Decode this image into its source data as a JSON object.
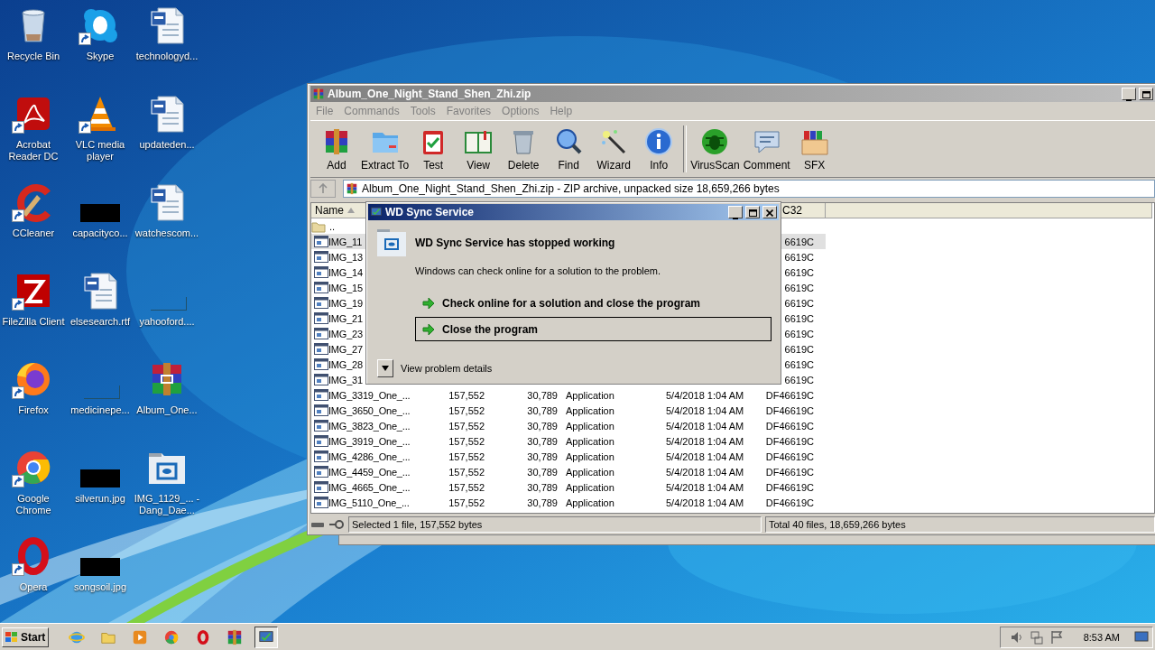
{
  "desktop": {
    "icons": [
      {
        "label": "Recycle Bin",
        "shortcut": false
      },
      {
        "label": "Skype",
        "shortcut": true
      },
      {
        "label": "technologyd...",
        "shortcut": false
      },
      {
        "label": "Acrobat Reader DC",
        "shortcut": true
      },
      {
        "label": "VLC media player",
        "shortcut": true
      },
      {
        "label": "updateden...",
        "shortcut": false
      },
      {
        "label": "CCleaner",
        "shortcut": true
      },
      {
        "label": "capacityco...",
        "shortcut": false
      },
      {
        "label": "watchescom...",
        "shortcut": false
      },
      {
        "label": "FileZilla Client",
        "shortcut": true
      },
      {
        "label": "elsesearch.rtf",
        "shortcut": false
      },
      {
        "label": "yahooford....",
        "shortcut": false
      },
      {
        "label": "Firefox",
        "shortcut": true
      },
      {
        "label": "medicinepe...",
        "shortcut": false
      },
      {
        "label": "Album_One...",
        "shortcut": false
      },
      {
        "label": "Google Chrome",
        "shortcut": true
      },
      {
        "label": "silverun.jpg",
        "shortcut": false
      },
      {
        "label": "IMG_1129_... - Dang_Dae...",
        "shortcut": false
      },
      {
        "label": "Opera",
        "shortcut": true
      },
      {
        "label": "songsoil.jpg",
        "shortcut": false
      }
    ]
  },
  "archive_window": {
    "title": "Album_One_Night_Stand_Shen_Zhi.zip",
    "active": false,
    "menu": [
      "File",
      "Commands",
      "Tools",
      "Favorites",
      "Options",
      "Help"
    ],
    "toolbar": {
      "groups": [
        {
          "buttons": [
            "Add",
            "Extract To",
            "Test",
            "View",
            "Delete",
            "Find",
            "Wizard",
            "Info"
          ]
        },
        {
          "buttons": [
            "VirusScan",
            "Comment",
            "SFX"
          ]
        }
      ]
    },
    "path": "Album_One_Night_Stand_Shen_Zhi.zip - ZIP archive, unpacked size 18,659,266 bytes",
    "table": {
      "columns": [
        {
          "label": "Name",
          "sorted": true
        },
        {
          "label": "C32",
          "sorted": false
        }
      ],
      "parent_row": {
        "name": ".."
      },
      "rows": [
        {
          "name": "IMG_11",
          "crc": "6619C",
          "selected": true
        },
        {
          "name": "IMG_13",
          "crc": "6619C",
          "selected": false
        },
        {
          "name": "IMG_14",
          "crc": "6619C",
          "selected": false
        },
        {
          "name": "IMG_15",
          "crc": "6619C",
          "selected": false
        },
        {
          "name": "IMG_19",
          "crc": "6619C",
          "selected": false
        },
        {
          "name": "IMG_21",
          "crc": "6619C",
          "selected": false
        },
        {
          "name": "IMG_23",
          "crc": "6619C",
          "selected": false
        },
        {
          "name": "IMG_27",
          "crc": "6619C",
          "selected": false
        },
        {
          "name": "IMG_28",
          "crc": "6619C",
          "selected": false
        },
        {
          "name": "IMG_31",
          "crc": "6619C",
          "selected": false
        },
        {
          "name": "IMG_3319_One_...",
          "size": "157,552",
          "packed": "30,789",
          "type": "Application",
          "modified": "5/4/2018 1:04 AM",
          "crc": "DF46619C",
          "selected": false
        },
        {
          "name": "IMG_3650_One_...",
          "size": "157,552",
          "packed": "30,789",
          "type": "Application",
          "modified": "5/4/2018 1:04 AM",
          "crc": "DF46619C",
          "selected": false
        },
        {
          "name": "IMG_3823_One_...",
          "size": "157,552",
          "packed": "30,789",
          "type": "Application",
          "modified": "5/4/2018 1:04 AM",
          "crc": "DF46619C",
          "selected": false
        },
        {
          "name": "IMG_3919_One_...",
          "size": "157,552",
          "packed": "30,789",
          "type": "Application",
          "modified": "5/4/2018 1:04 AM",
          "crc": "DF46619C",
          "selected": false
        },
        {
          "name": "IMG_4286_One_...",
          "size": "157,552",
          "packed": "30,789",
          "type": "Application",
          "modified": "5/4/2018 1:04 AM",
          "crc": "DF46619C",
          "selected": false
        },
        {
          "name": "IMG_4459_One_...",
          "size": "157,552",
          "packed": "30,789",
          "type": "Application",
          "modified": "5/4/2018 1:04 AM",
          "crc": "DF46619C",
          "selected": false
        },
        {
          "name": "IMG_4665_One_...",
          "size": "157,552",
          "packed": "30,789",
          "type": "Application",
          "modified": "5/4/2018 1:04 AM",
          "crc": "DF46619C",
          "selected": false
        },
        {
          "name": "IMG_5110_One_...",
          "size": "157,552",
          "packed": "30,789",
          "type": "Application",
          "modified": "5/4/2018 1:04 AM",
          "crc": "DF46619C",
          "selected": false
        }
      ]
    },
    "status_bar": {
      "selection": "Selected 1 file, 157,552 bytes",
      "total": "Total 40 files, 18,659,266 bytes"
    }
  },
  "error_dialog": {
    "title": "WD Sync Service",
    "active": true,
    "heading": "WD Sync Service has stopped working",
    "message": "Windows can check online for a solution to the problem.",
    "options": [
      {
        "label": "Check online for a solution and close the program",
        "focused": false
      },
      {
        "label": "Close the program",
        "focused": true
      }
    ],
    "details_label": "View problem details"
  },
  "taskbar": {
    "start_label": "Start",
    "buttons": [
      {
        "pressed": false
      },
      {
        "pressed": false
      },
      {
        "pressed": false
      },
      {
        "pressed": false
      },
      {
        "pressed": false
      },
      {
        "pressed": false
      },
      {
        "pressed": true
      }
    ],
    "clock": "8:53 AM"
  }
}
